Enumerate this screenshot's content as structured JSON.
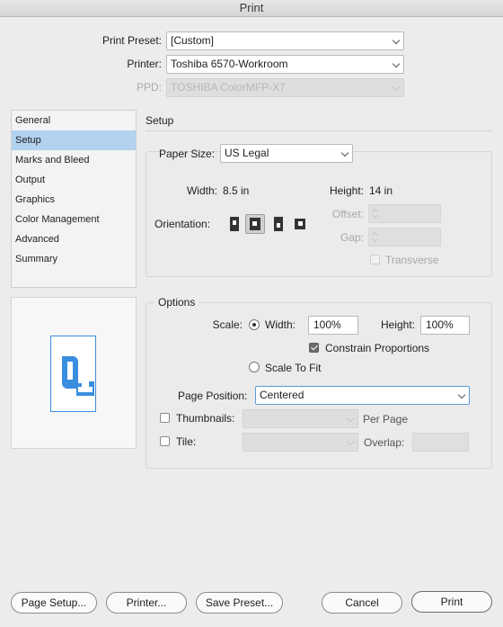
{
  "window": {
    "title": "Print"
  },
  "top": {
    "preset_label": "Print Preset:",
    "preset_value": "[Custom]",
    "printer_label": "Printer:",
    "printer_value": "Toshiba 6570-Workroom",
    "ppd_label": "PPD:",
    "ppd_value": "TOSHIBA ColorMFP-X7"
  },
  "sidebar": {
    "items": [
      {
        "label": "General"
      },
      {
        "label": "Setup"
      },
      {
        "label": "Marks and Bleed"
      },
      {
        "label": "Output"
      },
      {
        "label": "Graphics"
      },
      {
        "label": "Color Management"
      },
      {
        "label": "Advanced"
      },
      {
        "label": "Summary"
      }
    ],
    "selected": "Setup"
  },
  "setup": {
    "section_title": "Setup",
    "paper_size_label": "Paper Size:",
    "paper_size_value": "US Legal",
    "width_label": "Width:",
    "width_value": "8.5 in",
    "height_label": "Height:",
    "height_value": "14 in",
    "orientation_label": "Orientation:",
    "offset_label": "Offset:",
    "gap_label": "Gap:",
    "transverse_label": "Transverse"
  },
  "options": {
    "section_title": "Options",
    "scale_label": "Scale:",
    "width_label": "Width:",
    "width_value": "100%",
    "height_label": "Height:",
    "height_value": "100%",
    "constrain_label": "Constrain Proportions",
    "scale_to_fit_label": "Scale To Fit",
    "page_position_label": "Page Position:",
    "page_position_value": "Centered",
    "thumbnails_label": "Thumbnails:",
    "per_page_label": "Per Page",
    "tile_label": "Tile:",
    "overlap_label": "Overlap:"
  },
  "buttons": {
    "page_setup": "Page Setup...",
    "printer": "Printer...",
    "save_preset": "Save Preset...",
    "cancel": "Cancel",
    "print": "Print"
  },
  "colors": {
    "selection": "#b3d2f0",
    "preview_blue": "#3a8ee0"
  }
}
